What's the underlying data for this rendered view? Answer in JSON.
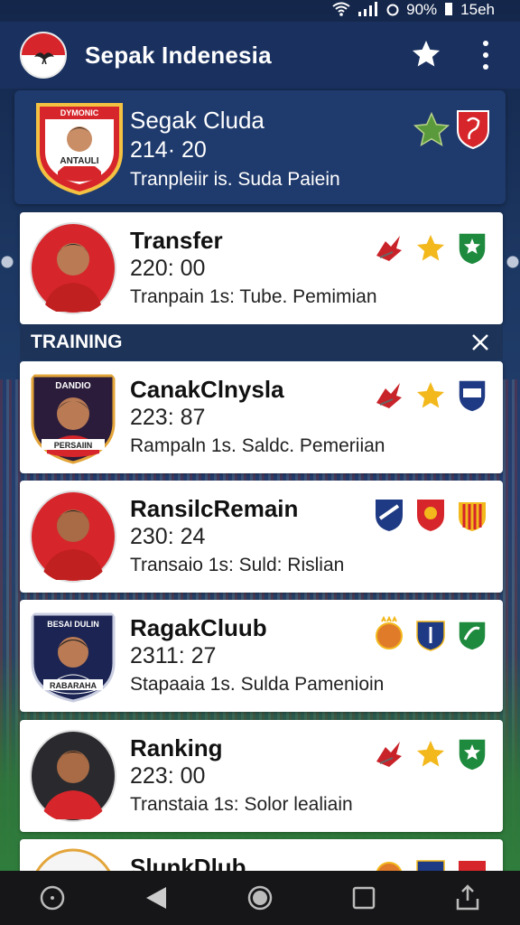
{
  "status_bar": {
    "battery": "90%",
    "time": "15eh",
    "wifi_icon": "wifi-icon",
    "signal_icon": "signal-icon",
    "alarm_icon": "alarm-icon"
  },
  "app_bar": {
    "title": "Sepak Indenesia",
    "logo_icon": "indonesia-flag-logo",
    "star_icon": "star-icon",
    "menu_icon": "more-vert-icon"
  },
  "featured": {
    "name": "Segak Cluda",
    "score": "214· 20",
    "desc": "Tranpleiir is. Suda Paiein",
    "crest_top": "DYMONIC",
    "crest_bottom": "ANTAULI",
    "badges": [
      "star-icon",
      "shield-icon"
    ],
    "colors": {
      "star": "#5a9a3c",
      "shield": "#d6262b"
    }
  },
  "section": {
    "title": "TRAINING",
    "close_icon": "close-icon"
  },
  "cards": [
    {
      "name": "Transfer",
      "score": "220: 00",
      "desc": "Tranpain 1s: Tube. Pemimian",
      "badges": [
        "eagle-icon",
        "star-icon",
        "shield-star-icon"
      ]
    },
    {
      "name": "CanakClnysla",
      "score": "223: 87",
      "desc": "Rampaln 1s. Saldc. Pemeriian",
      "crest_top": "DANDIO",
      "crest_bottom": "PERSAIIN",
      "badges": [
        "eagle-icon",
        "star-icon",
        "club-crest-icon"
      ]
    },
    {
      "name": "RansilcRemain",
      "score": "230: 24",
      "desc": "Transaio 1s: Suld: Rislian",
      "badges": [
        "club-crest-icon",
        "club-crest-icon",
        "club-crest-icon"
      ]
    },
    {
      "name": "RagakCluub",
      "score": "2311: 27",
      "desc": "Stapaaia 1s. Sulda Pamenioin",
      "crest_top": "BESAI DULIN",
      "crest_bottom": "RABARAHA",
      "badges": [
        "club-crest-icon",
        "club-crest-icon",
        "shield-icon"
      ]
    },
    {
      "name": "Ranking",
      "score": "223: 00",
      "desc": "Transtaia 1s: Solor lealiain",
      "badges": [
        "eagle-icon",
        "star-icon",
        "shield-star-icon"
      ]
    },
    {
      "name": "SlunkDlub",
      "score": "",
      "desc": "",
      "badges": [
        "club-crest-icon",
        "club-crest-icon",
        "club-crest-icon"
      ]
    }
  ],
  "nav_bar": {
    "items": [
      "home-icon",
      "back-icon",
      "recent-icon",
      "square-icon",
      "share-icon"
    ]
  }
}
